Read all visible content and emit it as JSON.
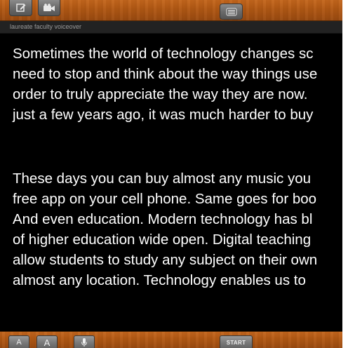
{
  "top_toolbar": {
    "buttons": [
      {
        "name": "edit",
        "icon": "edit-icon"
      },
      {
        "name": "video",
        "icon": "video-camera-icon"
      },
      {
        "name": "text-to-speech",
        "icon": "speaker-icon"
      }
    ]
  },
  "document": {
    "title": "laureate faculty voiceover",
    "paragraphs": [
      {
        "lines": [
          "Sometimes the world of technology changes sc",
          "need to stop and think about the way things use",
          "order to truly appreciate the way they are now.",
          "just a few years ago, it was much harder to buy"
        ]
      },
      {
        "lines": [
          "These days you can buy almost any music you",
          "free app on your cell phone. Same goes for boo",
          "And even education. Modern technology has bl",
          "of higher education wide open. Digital teaching",
          "allow students to study any subject on their own",
          "almost any location. Technology enables us to"
        ]
      }
    ]
  },
  "bottom_toolbar": {
    "font_small_label": "A",
    "font_large_label": "A",
    "start_label": "START"
  },
  "colors": {
    "toolbar_wood": "#b35914",
    "text": "#ffffff",
    "background": "#000000",
    "title_text": "#9a9a9a"
  }
}
